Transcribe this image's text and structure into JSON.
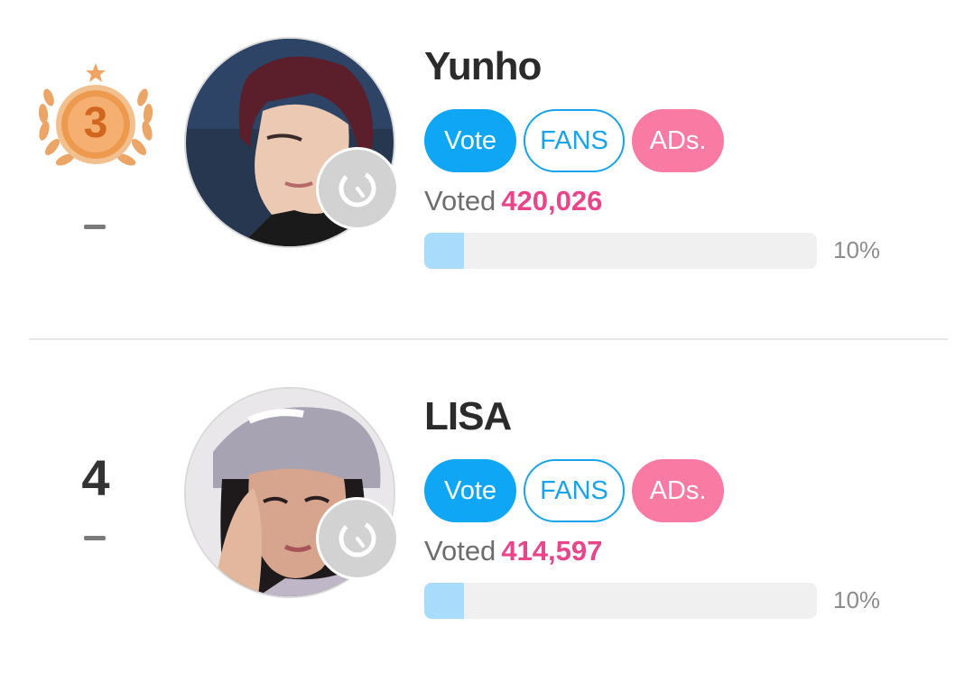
{
  "colors": {
    "vote_button": "#0fa7f5",
    "fans_button_border": "#1aa3ea",
    "ads_button": "#f97aa3",
    "vote_count": "#e8458b",
    "progress_fill": "#a9dcfb",
    "progress_track": "#f0f0f0",
    "medal_bronze": "#e8883f"
  },
  "entries": [
    {
      "name": "Yunho",
      "rank": "3",
      "rank_icon": "bronze-medal-laurel-icon",
      "rank_change": "–",
      "avatar_icon": "artist-photo",
      "badge_icon": "refresh-badge-icon",
      "buttons": {
        "vote": "Vote",
        "fans": "FANS",
        "ads": "ADs."
      },
      "voted_label": "Voted",
      "vote_count": "420,026",
      "progress_fraction": 0.1,
      "percent_label": "10%"
    },
    {
      "name": "LISA",
      "rank": "4",
      "rank_change": "–",
      "avatar_icon": "artist-photo",
      "badge_icon": "refresh-badge-icon",
      "buttons": {
        "vote": "Vote",
        "fans": "FANS",
        "ads": "ADs."
      },
      "voted_label": "Voted",
      "vote_count": "414,597",
      "progress_fraction": 0.1,
      "percent_label": "10%"
    }
  ]
}
